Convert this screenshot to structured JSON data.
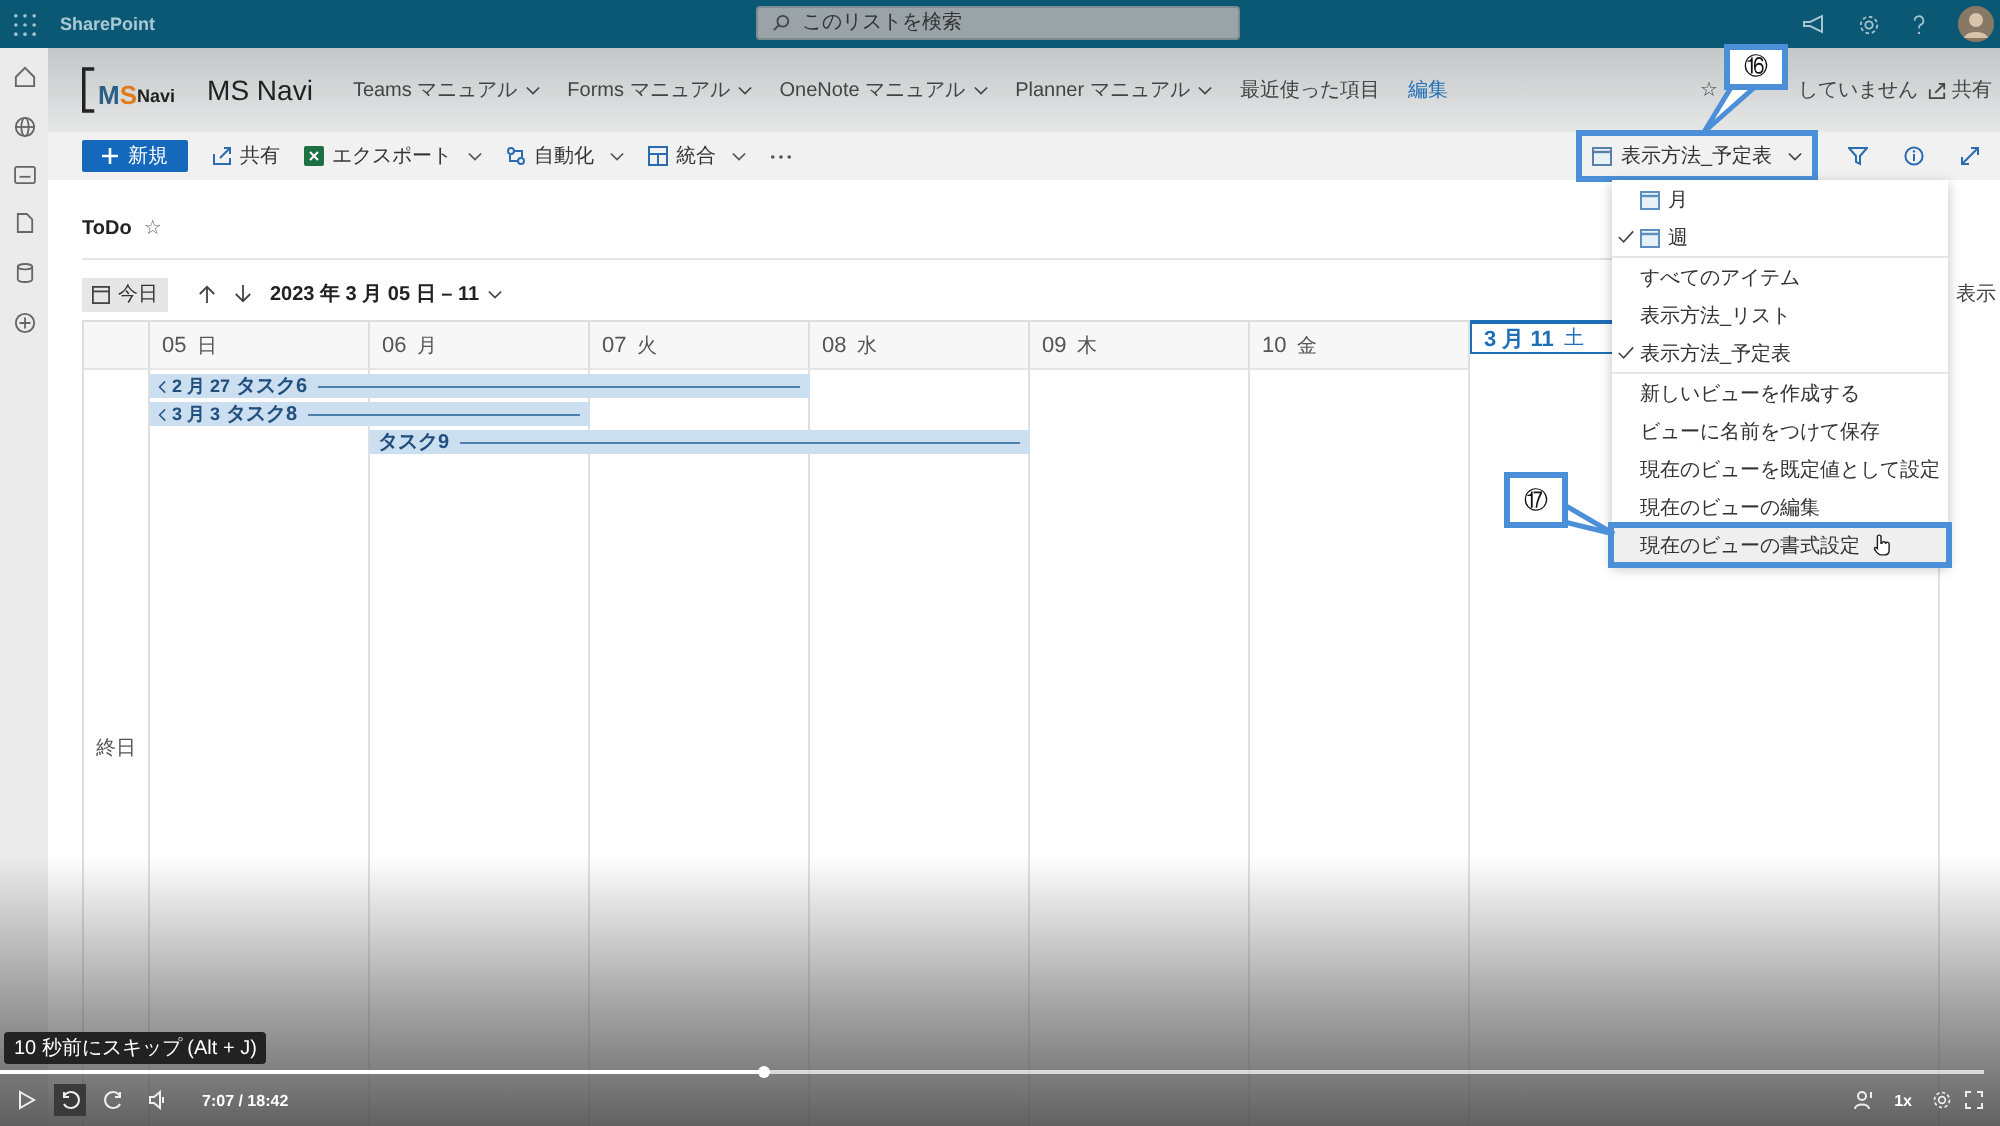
{
  "top_bar": {
    "app_name": "SharePoint",
    "search": {
      "placeholder": "このリストを検索"
    }
  },
  "site_header": {
    "logo": [
      "M",
      "S",
      "Navi"
    ],
    "title": "MS Navi",
    "nav": [
      {
        "label": "Teams マニュアル",
        "kind": "menu"
      },
      {
        "label": "Forms マニュアル",
        "kind": "menu"
      },
      {
        "label": "OneNote マニュアル",
        "kind": "menu"
      },
      {
        "label": "Planner マニュアル",
        "kind": "menu"
      },
      {
        "label": "最近使った項目",
        "kind": "plain"
      },
      {
        "label": "編集",
        "kind": "link"
      }
    ],
    "follow": {
      "star": "☆",
      "label": "していません"
    },
    "share": "共有"
  },
  "command_bar": {
    "new_button": "新規",
    "items": [
      {
        "label": "共有",
        "has_menu": false
      },
      {
        "label": "エクスポート",
        "has_menu": true
      },
      {
        "label": "自動化",
        "has_menu": true
      },
      {
        "label": "統合",
        "has_menu": true
      }
    ],
    "view_selector": {
      "label": "表示方法_予定表",
      "callout": "⑯"
    }
  },
  "list": {
    "title": "ToDo",
    "favorite": "☆"
  },
  "date_nav": {
    "today_button": "今日",
    "range": "2023 年 3 月 05 日 – 11",
    "partial_text": "表示"
  },
  "calendar": {
    "all_day_label": "終日",
    "days": [
      {
        "date": "05",
        "weekday": "日",
        "today": false
      },
      {
        "date": "06",
        "weekday": "月",
        "today": false
      },
      {
        "date": "07",
        "weekday": "火",
        "today": false
      },
      {
        "date": "08",
        "weekday": "水",
        "today": false
      },
      {
        "date": "09",
        "weekday": "木",
        "today": false
      },
      {
        "date": "10",
        "weekday": "金",
        "today": false
      },
      {
        "date": "3 月 11",
        "weekday": "土",
        "today": true
      }
    ],
    "events": [
      {
        "title": "タスク6",
        "start_label": "2 月 27",
        "continues_before": true,
        "on_days": [
          true,
          true,
          true,
          false,
          false,
          false,
          false
        ]
      },
      {
        "title": "タスク8",
        "start_label": "3 月 3",
        "continues_before": true,
        "on_days": [
          true,
          true,
          false,
          false,
          false,
          false,
          false
        ]
      },
      {
        "title": "タスク9",
        "continues_before": false,
        "on_days": [
          false,
          true,
          true,
          true,
          false,
          false,
          false
        ]
      }
    ]
  },
  "view_menu": {
    "sections": [
      [
        {
          "label": "月",
          "kind": "layout",
          "checked": false,
          "highlighted": false
        },
        {
          "label": "週",
          "kind": "layout",
          "checked": true,
          "highlighted": false
        }
      ],
      [
        {
          "label": "すべてのアイテム",
          "kind": "view",
          "checked": false,
          "highlighted": false
        },
        {
          "label": "表示方法_リスト",
          "kind": "view",
          "checked": false,
          "highlighted": false
        },
        {
          "label": "表示方法_予定表",
          "kind": "view",
          "checked": true,
          "highlighted": false
        }
      ],
      [
        {
          "label": "新しいビューを作成する",
          "kind": "action",
          "checked": false,
          "highlighted": false
        },
        {
          "label": "ビューに名前をつけて保存",
          "kind": "action",
          "checked": false,
          "highlighted": false
        },
        {
          "label": "現在のビューを既定値として設定",
          "kind": "action",
          "checked": false,
          "highlighted": false
        },
        {
          "label": "現在のビューの編集",
          "kind": "action",
          "checked": false,
          "highlighted": false
        },
        {
          "label": "現在のビューの書式設定",
          "kind": "action",
          "checked": false,
          "highlighted": true,
          "callout": "⑰"
        }
      ]
    ]
  },
  "player": {
    "tooltip": "10 秒前にスキップ (Alt + J)",
    "progress": {
      "level": 0.385
    },
    "controls": [
      {
        "kind": "play",
        "selected": false
      },
      {
        "kind": "skip_back",
        "selected": true
      },
      {
        "kind": "skip_forward",
        "selected": false
      },
      {
        "kind": "volume",
        "selected": false
      }
    ],
    "time": "7:07 / 18:42",
    "speed": "1x"
  }
}
